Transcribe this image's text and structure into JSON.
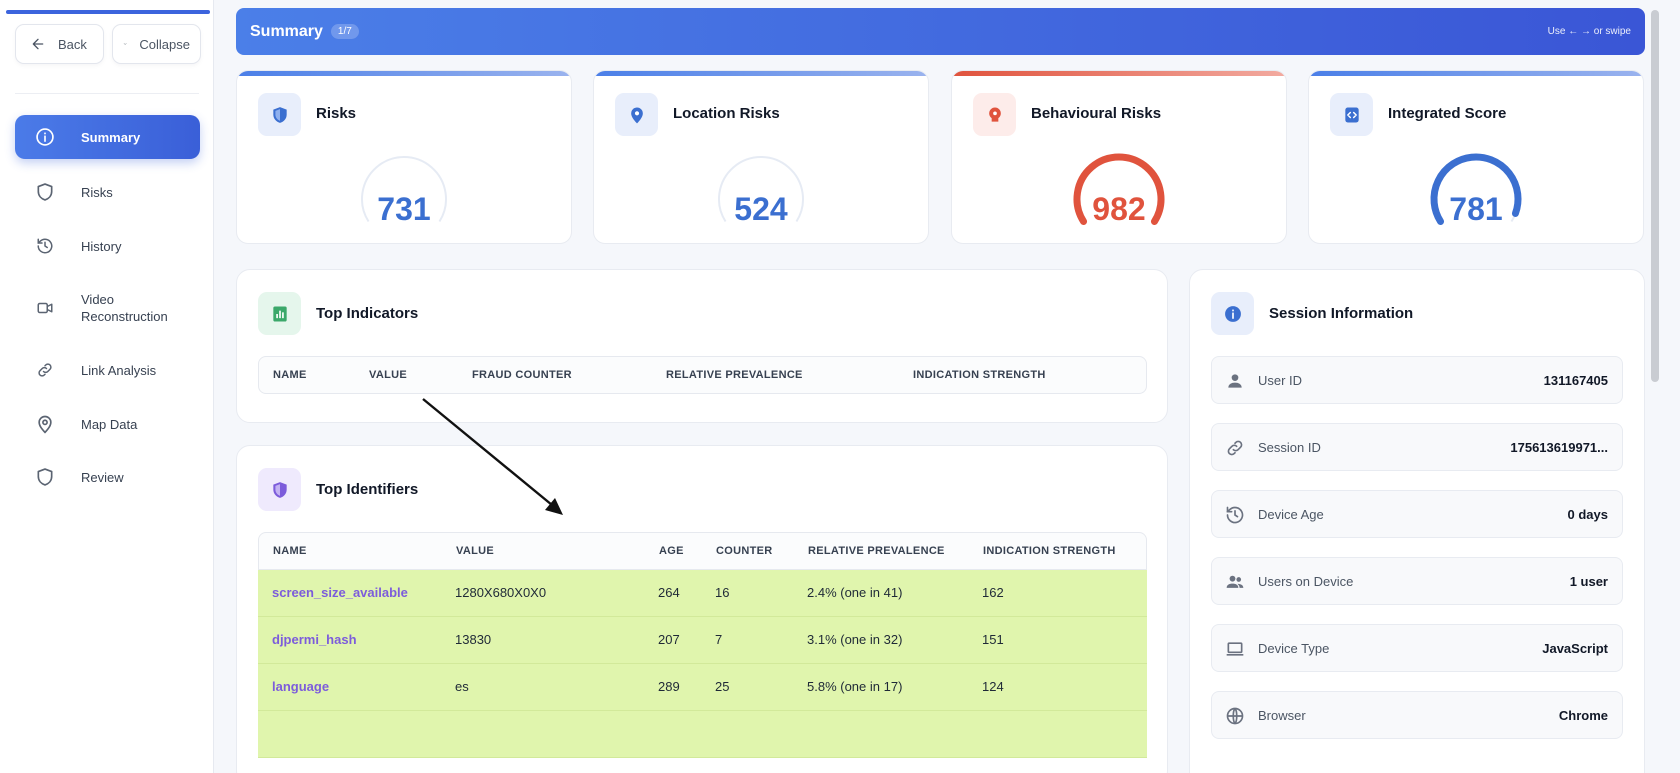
{
  "sidebar": {
    "back_label": "Back",
    "collapse_label": "Collapse",
    "items": [
      {
        "label": "Summary",
        "icon": "info-icon"
      },
      {
        "label": "Risks",
        "icon": "shield-icon"
      },
      {
        "label": "History",
        "icon": "history-icon"
      },
      {
        "label": "Video Reconstruction",
        "icon": "video-icon"
      },
      {
        "label": "Link Analysis",
        "icon": "link-icon"
      },
      {
        "label": "Map Data",
        "icon": "map-pin-icon"
      },
      {
        "label": "Review",
        "icon": "shield-icon"
      }
    ]
  },
  "header": {
    "title": "Summary",
    "badge": "1/7",
    "hint": "Use ← → or swipe"
  },
  "scores": [
    {
      "title": "Risks",
      "value": "731",
      "level": 0,
      "color": "#3b6fd0"
    },
    {
      "title": "Location Risks",
      "value": "524",
      "level": 0,
      "color": "#3b6fd0"
    },
    {
      "title": "Behavioural Risks",
      "value": "982",
      "level": 1,
      "color": "#e0533d"
    },
    {
      "title": "Integrated Score",
      "value": "781",
      "level": 0.95,
      "color": "#3b6fd0"
    }
  ],
  "top_indicators": {
    "title": "Top Indicators",
    "columns": [
      "NAME",
      "VALUE",
      "FRAUD COUNTER",
      "RELATIVE PREVALENCE",
      "INDICATION STRENGTH"
    ]
  },
  "top_identifiers": {
    "title": "Top Identifiers",
    "columns": [
      "NAME",
      "VALUE",
      "AGE",
      "COUNTER",
      "RELATIVE PREVALENCE",
      "INDICATION STRENGTH"
    ],
    "rows": [
      [
        "screen_size_available",
        "1280X680X0X0",
        "264",
        "16",
        "2.4% (one in 41)",
        "162"
      ],
      [
        "djpermi_hash",
        "13830",
        "207",
        "7",
        "3.1% (one in 32)",
        "151"
      ],
      [
        "language",
        "es",
        "289",
        "25",
        "5.8% (one in 17)",
        "124"
      ]
    ]
  },
  "session": {
    "title": "Session Information",
    "rows": [
      {
        "label": "User ID",
        "value": "131167405",
        "icon": "user-icon"
      },
      {
        "label": "Session ID",
        "value": "175613619971...",
        "icon": "link-icon"
      },
      {
        "label": "Device Age",
        "value": "0 days",
        "icon": "history-icon"
      },
      {
        "label": "Users on Device",
        "value": "1 user",
        "icon": "users-icon"
      },
      {
        "label": "Device Type",
        "value": "JavaScript",
        "icon": "laptop-icon"
      },
      {
        "label": "Browser",
        "value": "Chrome",
        "icon": "globe-icon"
      }
    ]
  },
  "colors": {
    "accent": "#3c64dd",
    "row_highlight": "#e0f5ad",
    "link": "#7c5cdb",
    "risk_red": "#e0533d"
  }
}
